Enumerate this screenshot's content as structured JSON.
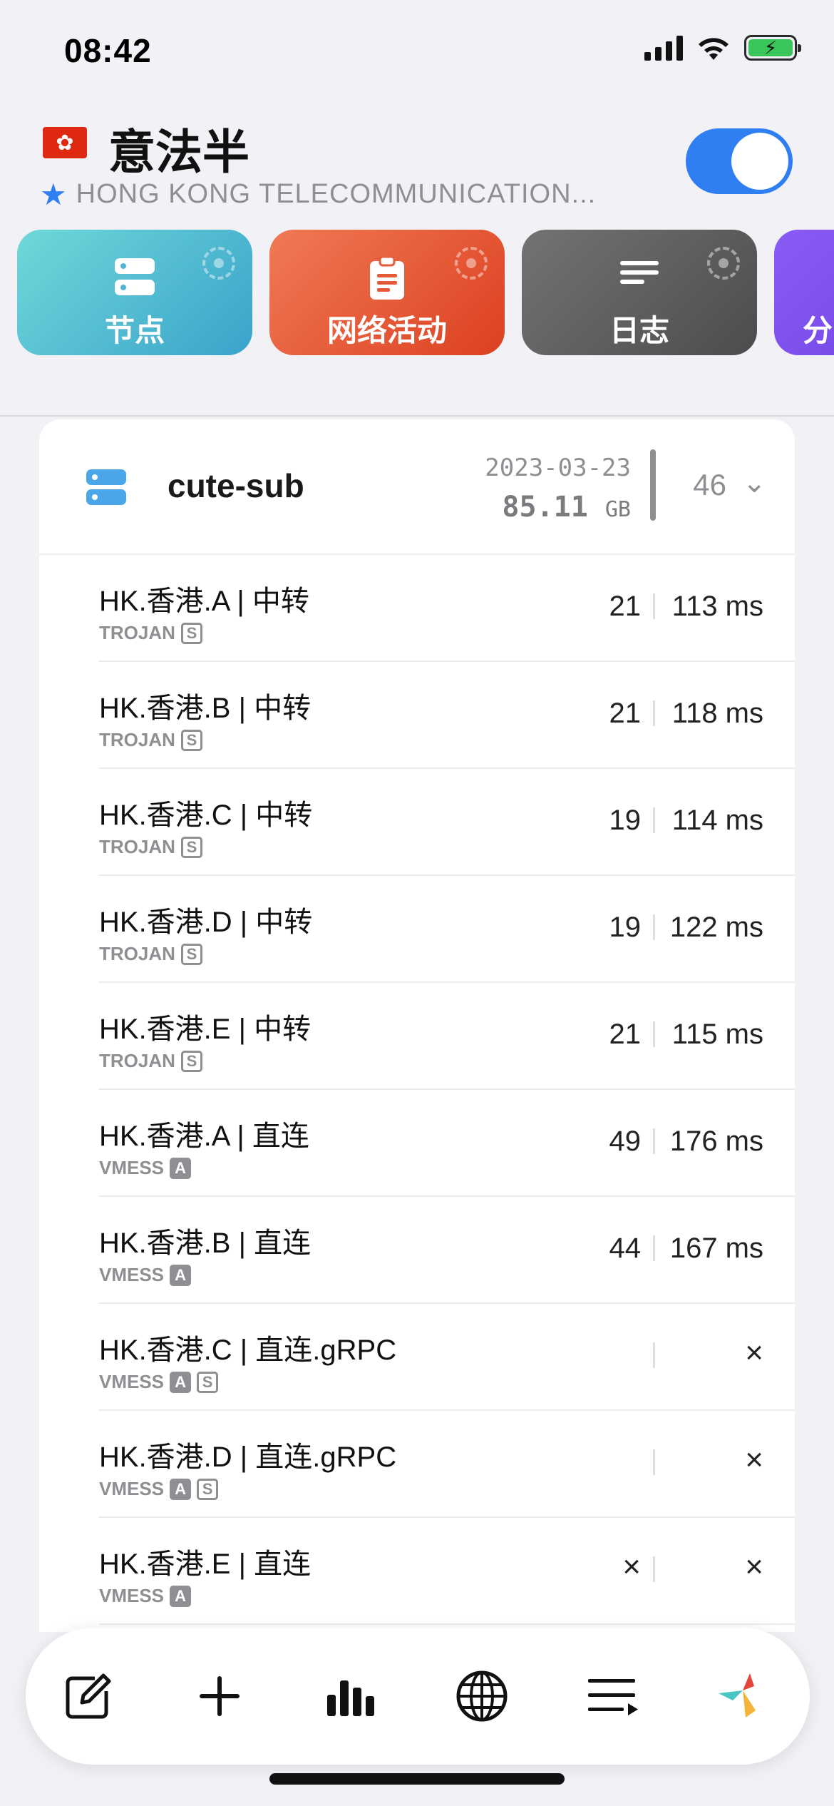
{
  "status_bar": {
    "time": "08:42"
  },
  "header": {
    "title": "意法半",
    "subtitle": "HONG KONG TELECOMMUNICATION...",
    "toggle_on": true
  },
  "tabs": [
    {
      "label": "节点",
      "icon": "server-stack-icon",
      "selected": true
    },
    {
      "label": "网络活动",
      "icon": "clipboard-icon",
      "selected": false
    },
    {
      "label": "日志",
      "icon": "lines-icon",
      "selected": false
    },
    {
      "label": "分",
      "icon": "",
      "selected": false
    }
  ],
  "subscription": {
    "name": "cute-sub",
    "date": "2023-03-23",
    "size": "85.11",
    "size_unit": "GB",
    "count": "46"
  },
  "nodes": [
    {
      "name": "HK.香港.A | 中转",
      "protocol": "TROJAN",
      "badges": [
        "S"
      ],
      "count": "21",
      "latency": "113 ms"
    },
    {
      "name": "HK.香港.B | 中转",
      "protocol": "TROJAN",
      "badges": [
        "S"
      ],
      "count": "21",
      "latency": "118 ms"
    },
    {
      "name": "HK.香港.C | 中转",
      "protocol": "TROJAN",
      "badges": [
        "S"
      ],
      "count": "19",
      "latency": "114 ms"
    },
    {
      "name": "HK.香港.D | 中转",
      "protocol": "TROJAN",
      "badges": [
        "S"
      ],
      "count": "19",
      "latency": "122 ms"
    },
    {
      "name": "HK.香港.E | 中转",
      "protocol": "TROJAN",
      "badges": [
        "S"
      ],
      "count": "21",
      "latency": "115 ms"
    },
    {
      "name": "HK.香港.A | 直连",
      "protocol": "VMESS",
      "badges": [
        "A"
      ],
      "count": "49",
      "latency": "176 ms"
    },
    {
      "name": "HK.香港.B | 直连",
      "protocol": "VMESS",
      "badges": [
        "A"
      ],
      "count": "44",
      "latency": "167 ms"
    },
    {
      "name": "HK.香港.C | 直连.gRPC",
      "protocol": "VMESS",
      "badges": [
        "A",
        "S"
      ],
      "count": "",
      "latency": "×"
    },
    {
      "name": "HK.香港.D | 直连.gRPC",
      "protocol": "VMESS",
      "badges": [
        "A",
        "S"
      ],
      "count": "",
      "latency": "×"
    },
    {
      "name": "HK.香港.E | 直连",
      "protocol": "VMESS",
      "badges": [
        "A"
      ],
      "count": "×",
      "latency": "×"
    }
  ],
  "bottom_bar": [
    {
      "icon": "edit-icon"
    },
    {
      "icon": "plus-icon"
    },
    {
      "icon": "chart-icon"
    },
    {
      "icon": "globe-icon"
    },
    {
      "icon": "list-icon"
    },
    {
      "icon": "app-logo-icon"
    }
  ],
  "colors": {
    "accent": "#2f7ff3",
    "nodes_tab": "#3aa3cb",
    "net_tab": "#dc4020",
    "log_tab": "#4c4c4c"
  }
}
